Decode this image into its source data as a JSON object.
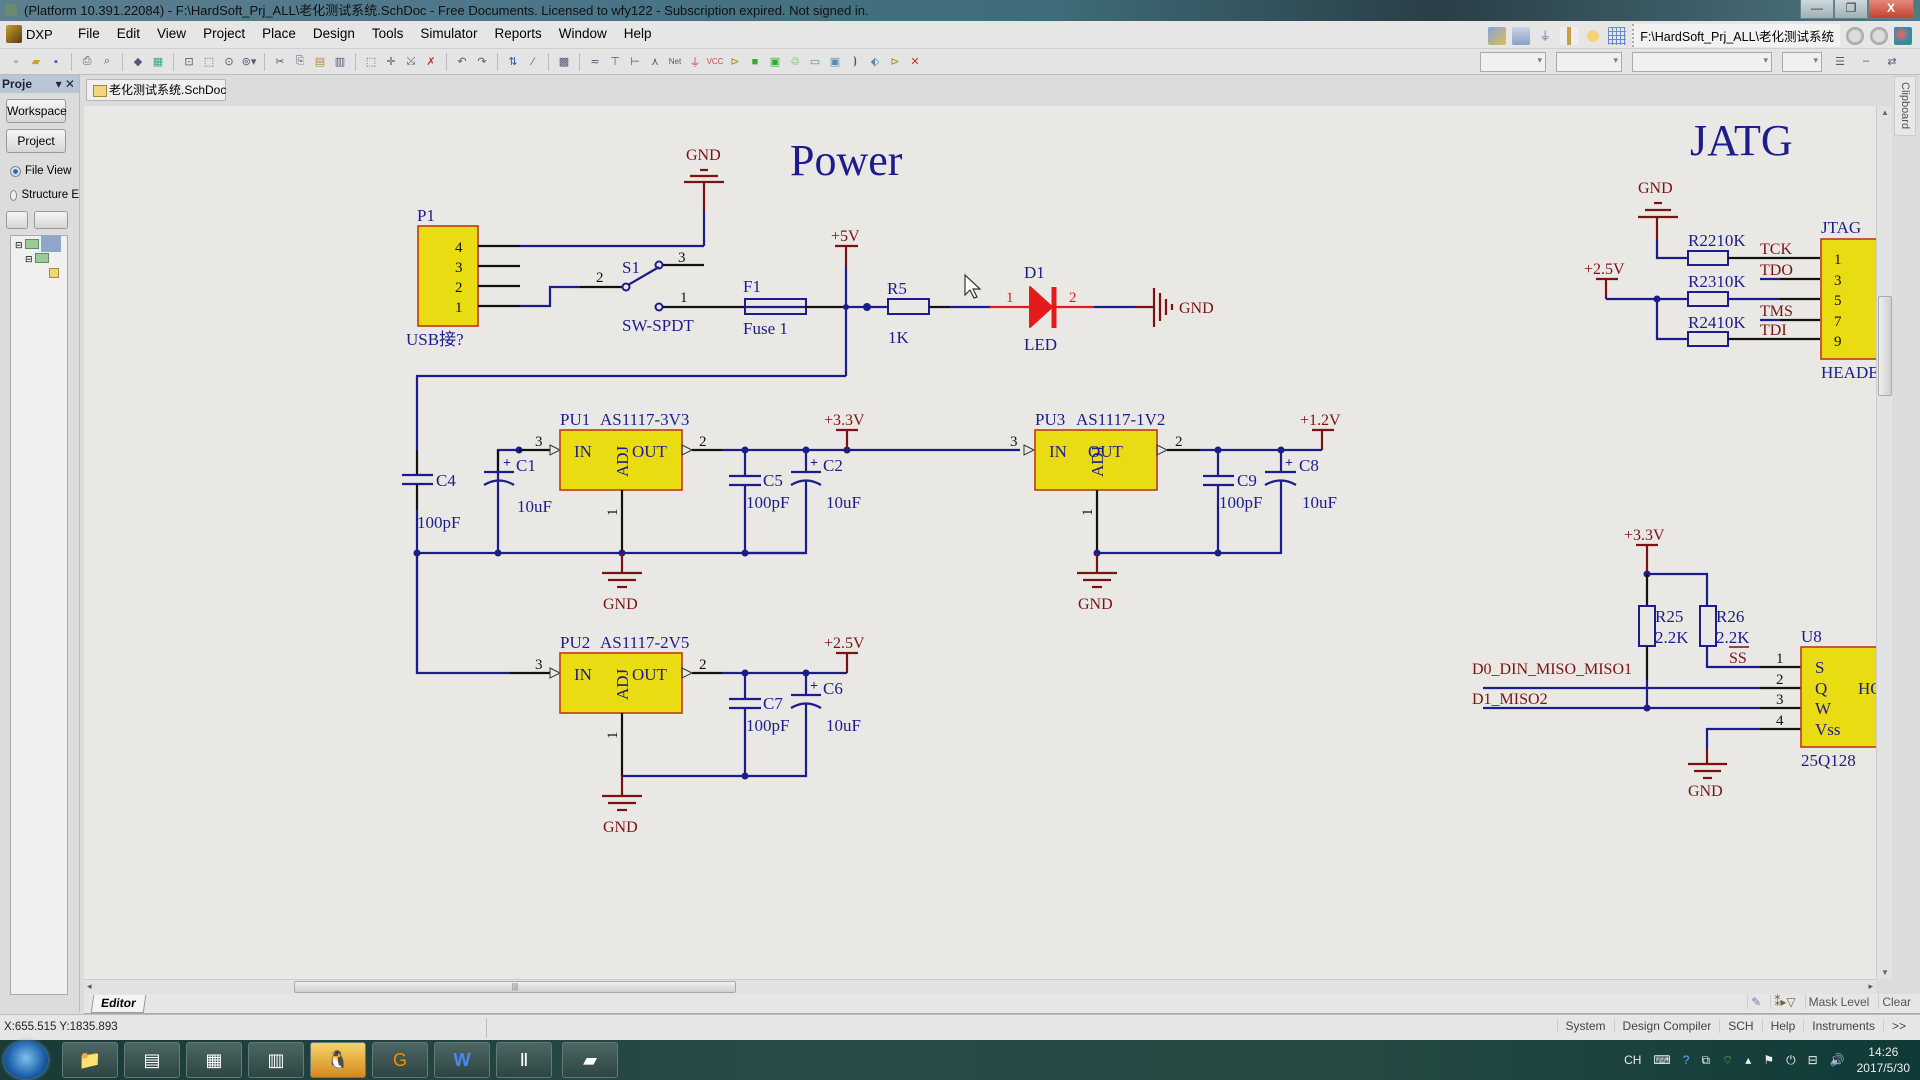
{
  "window": {
    "title": "(Platform 10.391.22084) - F:\\HardSoft_Prj_ALL\\老化测试系统.SchDoc - Free Documents. Licensed to wfy122 - Subscription expired. Not signed in.",
    "controls": {
      "minimize": "—",
      "restore": "❐",
      "close": "X"
    }
  },
  "menubar": {
    "dxp_label": "DXP",
    "items": [
      {
        "label": "File"
      },
      {
        "label": "Edit"
      },
      {
        "label": "View"
      },
      {
        "label": "Project"
      },
      {
        "label": "Place"
      },
      {
        "label": "Design"
      },
      {
        "label": "Tools"
      },
      {
        "label": "Simulator"
      },
      {
        "label": "Reports"
      },
      {
        "label": "Window"
      },
      {
        "label": "Help"
      }
    ],
    "path_box": "F:\\HardSoft_Prj_ALL\\老化测试系统"
  },
  "toolbar": {
    "icons": [
      "new-icon",
      "open-icon",
      "save-icon",
      "print-icon",
      "print-preview-icon",
      "3d-icon",
      "board-icon",
      "zoom-fit-icon",
      "zoom-area-icon",
      "zoom-select-icon",
      "zoom-dropdown-icon",
      "cut-icon",
      "copy-icon",
      "paste-icon",
      "rubber-stamp-icon",
      "select-area-icon",
      "move-icon",
      "deselect-icon",
      "clear-filter-icon",
      "undo-icon",
      "redo-icon",
      "hierarchy-icon",
      "cross-probe-icon",
      "browse-library-icon",
      "wire-icon",
      "bus-icon",
      "bus-entry-icon",
      "net-label-icon",
      "net-icon",
      "gnd-port-icon",
      "vcc-port-icon",
      "part-icon",
      "sheet-symbol-icon",
      "sheet-entry-icon",
      "device-sheet-icon",
      "harness-icon",
      "harness-connector-icon",
      "harness-entry-icon",
      "port-icon",
      "off-sheet-icon",
      "no-erc-icon"
    ]
  },
  "left_panel": {
    "title": "Proje",
    "workspace_button": "Workspace",
    "project_button": "Project",
    "radio_file_view": "File View",
    "radio_structure": "Structure E"
  },
  "doc_tab": "老化测试系统.SchDoc",
  "clipboard_tab": "Clipboard",
  "schematic": {
    "power_title": "Power",
    "jtag_title": "JATG",
    "P1": {
      "ref": "P1",
      "comment": "USB接?",
      "pins": [
        "4",
        "3",
        "2",
        "1"
      ]
    },
    "S1": {
      "ref": "S1",
      "comment": "SW-SPDT",
      "pins": [
        "1",
        "2",
        "3"
      ]
    },
    "F1": {
      "ref": "F1",
      "comment": "Fuse 1"
    },
    "R5": {
      "ref": "R5",
      "value": "1K"
    },
    "D1": {
      "ref": "D1",
      "comment": "LED",
      "pin1": "1",
      "pin2": "2"
    },
    "ports": {
      "gnd": "GND",
      "v5": "+5V",
      "v33": "+3.3V",
      "v12": "+1.2V",
      "v25": "+2.5V"
    },
    "PU1": {
      "ref": "PU1",
      "part": "AS1117-3V3"
    },
    "PU2": {
      "ref": "PU2",
      "part": "AS1117-2V5"
    },
    "PU3": {
      "ref": "PU3",
      "part": "AS1117-1V2"
    },
    "reg_pins": {
      "in": "IN",
      "out": "OUT",
      "adj": "ADJ",
      "p1": "1",
      "p2": "2",
      "p3": "3"
    },
    "caps": {
      "C1": {
        "ref": "C1",
        "value": "10uF"
      },
      "C2": {
        "ref": "C2",
        "value": "10uF"
      },
      "C4": {
        "ref": "C4",
        "value": "100pF"
      },
      "C5": {
        "ref": "C5",
        "value": "100pF"
      },
      "C6": {
        "ref": "C6",
        "value": "10uF"
      },
      "C7": {
        "ref": "C7",
        "value": "100pF"
      },
      "C8": {
        "ref": "C8",
        "value": "10uF"
      },
      "C9": {
        "ref": "C9",
        "value": "100pF"
      }
    },
    "jtag": {
      "ref": "JTAG",
      "comment": "HEADE",
      "pins": [
        "1",
        "3",
        "5",
        "7",
        "9"
      ],
      "nets": [
        "TCK",
        "TDO",
        "TMS",
        "TDI"
      ],
      "R22": "R2210K",
      "R23": "R2310K",
      "R24": "R2410K"
    },
    "flash": {
      "ref": "U8",
      "part": "25Q128",
      "R25": "R25",
      "R26": "R26",
      "rval": "2.2K",
      "ss": "SS",
      "net_d0": "D0_DIN_MISO_MISO1",
      "net_d1": "D1_MISO2",
      "pin_nums": [
        "1",
        "2",
        "3",
        "4"
      ],
      "pin_names": [
        "S",
        "Q",
        "W",
        "Vss"
      ],
      "right_pin": "HO"
    }
  },
  "editor_bar": {
    "tab": "Editor",
    "mask_level": "Mask Level",
    "clear": "Clear"
  },
  "status_bar": {
    "coords": "X:655.515 Y:1835.893",
    "buttons": [
      "System",
      "Design Compiler",
      "SCH",
      "Help",
      "Instruments",
      ">>"
    ]
  },
  "taskbar": {
    "apps": [
      "file-explorer",
      "notepad",
      "control-panel",
      "winrar",
      "qq",
      "foxit-pdf",
      "word",
      "altium-designer",
      "app-last"
    ],
    "lang": "CH",
    "time": "14:26",
    "date": "2017/5/30"
  }
}
